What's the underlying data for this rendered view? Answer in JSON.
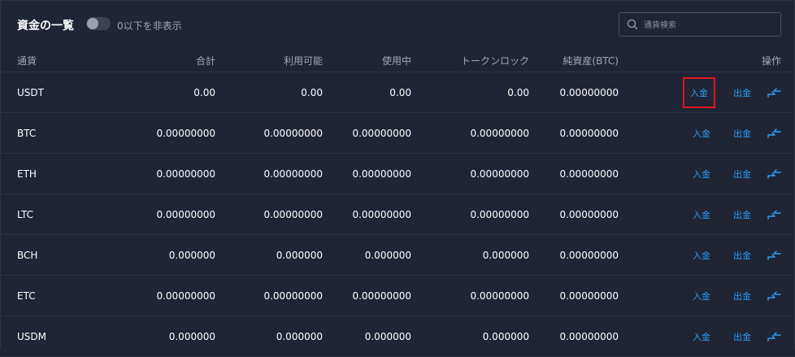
{
  "header": {
    "title": "資金の一覧",
    "hide_zero_label": "0以下を非表示",
    "search_placeholder": "通貨検索"
  },
  "table": {
    "columns": [
      "通貨",
      "合計",
      "利用可能",
      "使用中",
      "トークンロック",
      "純資産(BTC)",
      "操作"
    ],
    "deposit_label": "入金",
    "withdraw_label": "出金",
    "rows": [
      {
        "currency": "USDT",
        "total": "0.00",
        "available": "0.00",
        "in_use": "0.00",
        "token_lock": "0.00",
        "net_btc": "0.00000000"
      },
      {
        "currency": "BTC",
        "total": "0.00000000",
        "available": "0.00000000",
        "in_use": "0.00000000",
        "token_lock": "0.00000000",
        "net_btc": "0.00000000"
      },
      {
        "currency": "ETH",
        "total": "0.00000000",
        "available": "0.00000000",
        "in_use": "0.00000000",
        "token_lock": "0.00000000",
        "net_btc": "0.00000000"
      },
      {
        "currency": "LTC",
        "total": "0.00000000",
        "available": "0.00000000",
        "in_use": "0.00000000",
        "token_lock": "0.00000000",
        "net_btc": "0.00000000"
      },
      {
        "currency": "BCH",
        "total": "0.000000",
        "available": "0.000000",
        "in_use": "0.000000",
        "token_lock": "0.000000",
        "net_btc": "0.00000000"
      },
      {
        "currency": "ETC",
        "total": "0.00000000",
        "available": "0.00000000",
        "in_use": "0.00000000",
        "token_lock": "0.00000000",
        "net_btc": "0.00000000"
      },
      {
        "currency": "USDM",
        "total": "0.000000",
        "available": "0.000000",
        "in_use": "0.000000",
        "token_lock": "0.000000",
        "net_btc": "0.00000000"
      }
    ]
  },
  "colors": {
    "background": "#1f2535",
    "link": "#2d9cf5",
    "highlight": "#e0141b"
  },
  "icons": {
    "search": "search-icon",
    "transfer": "transfer-icon"
  }
}
